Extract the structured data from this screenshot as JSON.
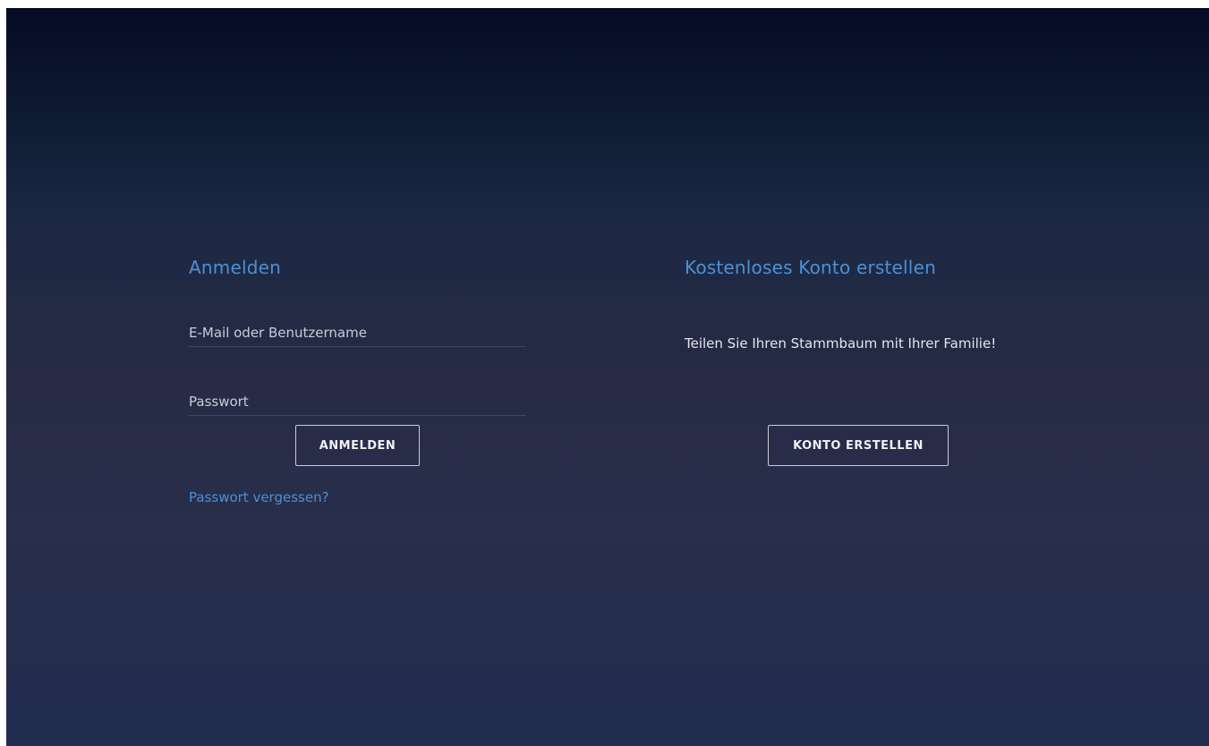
{
  "login": {
    "heading": "Anmelden",
    "email_placeholder": "E-Mail oder Benutzername",
    "password_placeholder": "Passwort",
    "submit_label": "ANMELDEN",
    "forgot_label": "Passwort vergessen?"
  },
  "signup": {
    "heading": "Kostenloses Konto erstellen",
    "tagline": "Teilen Sie Ihren Stammbaum mit Ihrer Familie!",
    "button_label": "KONTO ERSTELLEN"
  },
  "colors": {
    "accent": "#4a90d9",
    "background_top": "#050b24",
    "background_mid": "#272b45",
    "background_bottom": "#212c50"
  }
}
